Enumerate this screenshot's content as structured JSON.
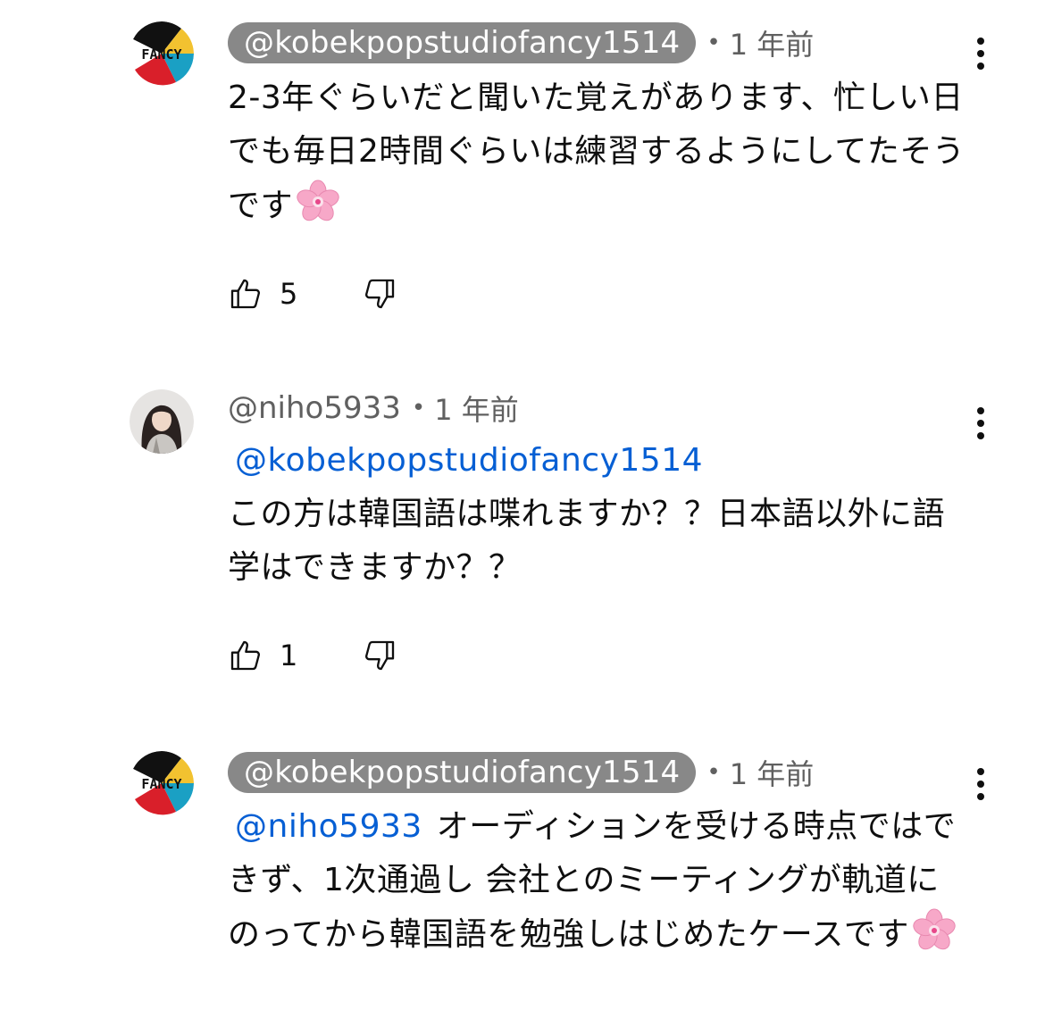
{
  "comments": [
    {
      "author": "@kobekpopstudiofancy1514",
      "author_style": "highlighted",
      "avatar": "fancy-logo",
      "avatar_text": "FANCY",
      "time": "1 年前",
      "text": "2-3年ぐらいだと聞いた覚えがあります、忙しい日でも毎日2時間ぐらいは練習するようにしてたそうです",
      "emoji": "cherry-blossom-emoji",
      "likes": "5"
    },
    {
      "author": "@niho5933",
      "author_style": "plain",
      "avatar": "user-photo",
      "time": "1 年前",
      "mention": "@kobekpopstudiofancy1514",
      "text": "この方は韓国語は喋れますか？？日本語以外に語学はできますか？？",
      "likes": "1"
    },
    {
      "author": "@kobekpopstudiofancy1514",
      "author_style": "highlighted",
      "avatar": "fancy-logo",
      "avatar_text": "FANCY",
      "time": "1 年前",
      "mention": "@niho5933",
      "text": "オーディションを受ける時点ではできず、1次通過し 会社とのミーティングが軌道にのってから韓国語を勉強しはじめたケースです",
      "emoji": "cherry-blossom-emoji"
    }
  ],
  "icons": {
    "like": "thumbs-up-icon",
    "dislike": "thumbs-down-icon",
    "menu": "more-vert-icon"
  },
  "colors": {
    "author_pill_bg": "#888888",
    "mention": "#065fd4",
    "meta_text": "#606060"
  }
}
